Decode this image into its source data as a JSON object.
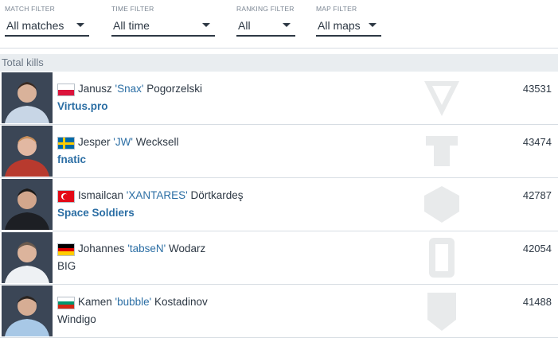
{
  "filters": [
    {
      "label": "MATCH FILTER",
      "value": "All matches"
    },
    {
      "label": "TIME FILTER",
      "value": "All time"
    },
    {
      "label": "RANKING FILTER",
      "value": "All"
    },
    {
      "label": "MAP FILTER",
      "value": "All maps"
    }
  ],
  "section_title": "Total kills",
  "players": [
    {
      "first": "Janusz",
      "nick": "'Snax'",
      "last": "Pogorzelski",
      "team": "Virtus.pro",
      "kills": "43531",
      "flag": "Poland",
      "jersey_color": "#c8d6e6"
    },
    {
      "first": "Jesper",
      "nick": "'JW'",
      "last": "Wecksell",
      "team": "fnatic",
      "kills": "43474",
      "flag": "Sweden",
      "jersey_color": "#b83a2e"
    },
    {
      "first": "Ismailcan",
      "nick": "'XANTARES'",
      "last": "Dörtkardeş",
      "team": "Space Soldiers",
      "kills": "42787",
      "flag": "Turkey",
      "jersey_color": "#1d1f24"
    },
    {
      "first": "Johannes",
      "nick": "'tabseN'",
      "last": "Wodarz",
      "team": "BIG",
      "kills": "42054",
      "flag": "Germany",
      "jersey_color": "#eef1f4"
    },
    {
      "first": "Kamen",
      "nick": "'bubble'",
      "last": "Kostadinov",
      "team": "Windigo",
      "kills": "41488",
      "flag": "Bulgaria",
      "jersey_color": "#a8c8e6"
    }
  ],
  "icons": {
    "dropdown": "chevron-down-icon",
    "team_logo": "team-logo-icon",
    "avatar": "player-photo"
  }
}
